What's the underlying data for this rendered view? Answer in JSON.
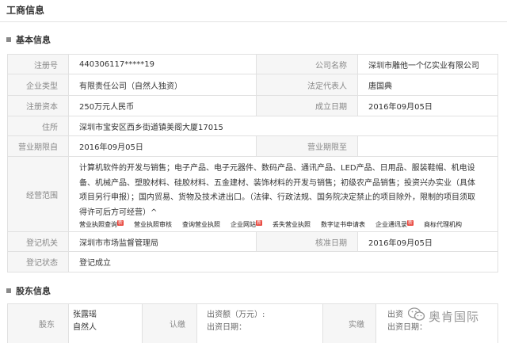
{
  "page": {
    "title": "工商信息"
  },
  "basic": {
    "heading": "基本信息",
    "reg_no": {
      "label": "注册号",
      "value": "440306117*****19"
    },
    "company_name": {
      "label": "公司名称",
      "value": "深圳市雕他一个亿实业有限公司"
    },
    "company_type": {
      "label": "企业类型",
      "value": "有限责任公司（自然人独资）"
    },
    "legal_rep": {
      "label": "法定代表人",
      "value": "唐国典"
    },
    "capital": {
      "label": "注册资本",
      "value": "250万元人民币"
    },
    "founded": {
      "label": "成立日期",
      "value": "2016年09月05日"
    },
    "address": {
      "label": "住所",
      "value": "深圳市宝安区西乡街道镇美阁大厦17015"
    },
    "term_from": {
      "label": "营业期限自",
      "value": "2016年09月05日"
    },
    "term_to": {
      "label": "营业期限至",
      "value": ""
    },
    "scope": {
      "label": "经营范围",
      "value": "计算机软件的开发与销售；电子产品、电子元器件、数码产品、通讯产品、LED产品、日用品、服装鞋帽、机电设备、机械产品、塑胶材料、硅胶材料、五金建材、装饰材料的开发与销售；初级农产品销售；投资兴办实业（具体项目另行申报）；国内贸易、货物及技术进出口。（法律、行政法规、国务院决定禁止的项目除外，限制的项目须取得许可后方可经营）^",
      "links": [
        {
          "label": "营业执照查询",
          "tag": "新"
        },
        {
          "label": "营业执照审核",
          "tag": ""
        },
        {
          "label": "查询营业执照",
          "tag": ""
        },
        {
          "label": "企业网站",
          "tag": "新"
        },
        {
          "label": "丢失营业执照",
          "tag": ""
        },
        {
          "label": "数字证书申请表",
          "tag": ""
        },
        {
          "label": "企业通讯录",
          "tag": "新"
        },
        {
          "label": "商标代理机构",
          "tag": ""
        }
      ]
    },
    "authority": {
      "label": "登记机关",
      "value": "深圳市市场监督管理局"
    },
    "approve_date": {
      "label": "核准日期",
      "value": "2016年09月05日"
    },
    "status": {
      "label": "登记状态",
      "value": "登记成立"
    }
  },
  "shareholders": {
    "heading": "股东信息",
    "col_holder": "股东",
    "holder_name": "张露瑶",
    "holder_type": "自然人",
    "col_subscribed": "认缴",
    "amount_label": "出资额（万元）:",
    "date_label": "出资日期：",
    "col_paid": "实缴",
    "paid_amount_label": "出资",
    "paid_date_label": "出资日期："
  },
  "watermark": {
    "text": "奥肯国际",
    "icon": "wechat-icon"
  }
}
